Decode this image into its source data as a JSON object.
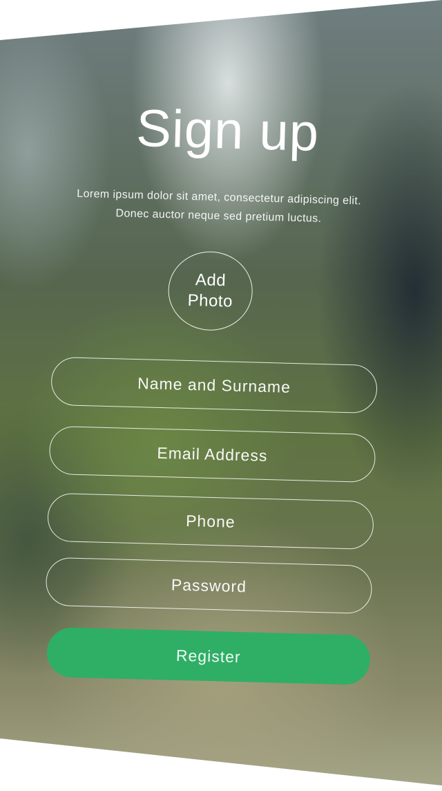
{
  "title": "Sign up",
  "subtitle_line1": "Lorem ipsum dolor sit amet, consectetur adipiscing elit.",
  "subtitle_line2": "Donec auctor neque sed pretium luctus.",
  "photo": {
    "line1": "Add",
    "line2": "Photo"
  },
  "fields": {
    "name_placeholder": "Name and Surname",
    "email_placeholder": "Email Address",
    "phone_placeholder": "Phone",
    "password_placeholder": "Password"
  },
  "register_label": "Register",
  "colors": {
    "accent": "#2fae66",
    "text": "#ffffff"
  }
}
